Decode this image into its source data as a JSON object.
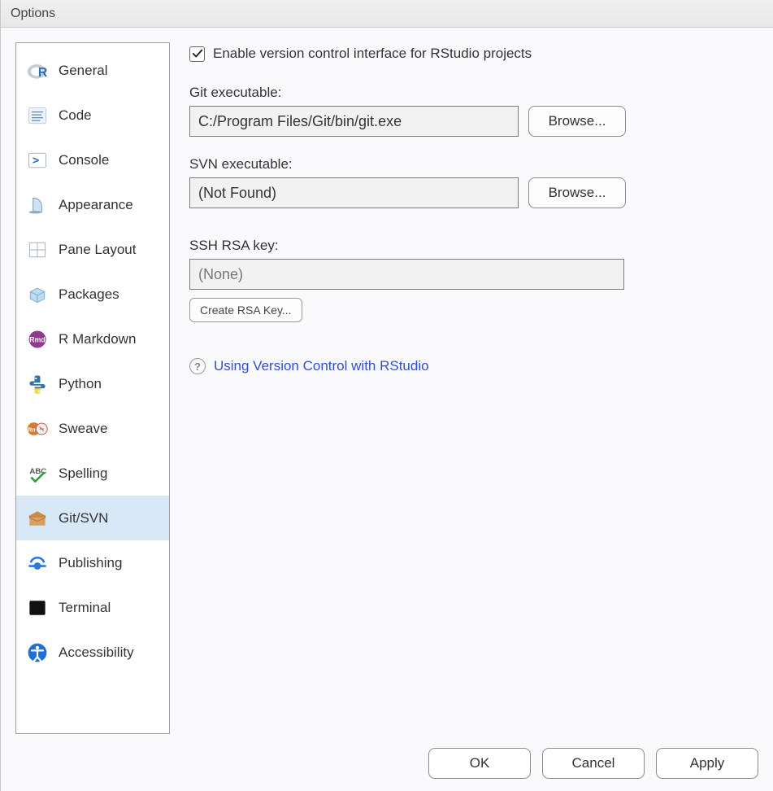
{
  "window": {
    "title": "Options"
  },
  "sidebar": {
    "items": [
      {
        "label": "General",
        "icon": "r-logo",
        "selected": false
      },
      {
        "label": "Code",
        "icon": "code",
        "selected": false
      },
      {
        "label": "Console",
        "icon": "console",
        "selected": false
      },
      {
        "label": "Appearance",
        "icon": "appearance",
        "selected": false
      },
      {
        "label": "Pane Layout",
        "icon": "panes",
        "selected": false
      },
      {
        "label": "Packages",
        "icon": "packages",
        "selected": false
      },
      {
        "label": "R Markdown",
        "icon": "rmarkdown",
        "selected": false
      },
      {
        "label": "Python",
        "icon": "python",
        "selected": false
      },
      {
        "label": "Sweave",
        "icon": "sweave",
        "selected": false
      },
      {
        "label": "Spelling",
        "icon": "spelling",
        "selected": false
      },
      {
        "label": "Git/SVN",
        "icon": "gitsvn",
        "selected": true
      },
      {
        "label": "Publishing",
        "icon": "publishing",
        "selected": false
      },
      {
        "label": "Terminal",
        "icon": "terminal",
        "selected": false
      },
      {
        "label": "Accessibility",
        "icon": "accessibility",
        "selected": false
      }
    ]
  },
  "main": {
    "enable_checkbox": {
      "checked": true,
      "label": "Enable version control interface for RStudio projects"
    },
    "git": {
      "label": "Git executable:",
      "value": "C:/Program Files/Git/bin/git.exe",
      "browse": "Browse..."
    },
    "svn": {
      "label": "SVN executable:",
      "value": "(Not Found)",
      "browse": "Browse..."
    },
    "ssh": {
      "label": "SSH RSA key:",
      "value": "(None)",
      "create": "Create RSA Key..."
    },
    "help": {
      "text": "Using Version Control with RStudio"
    }
  },
  "footer": {
    "ok": "OK",
    "cancel": "Cancel",
    "apply": "Apply"
  }
}
